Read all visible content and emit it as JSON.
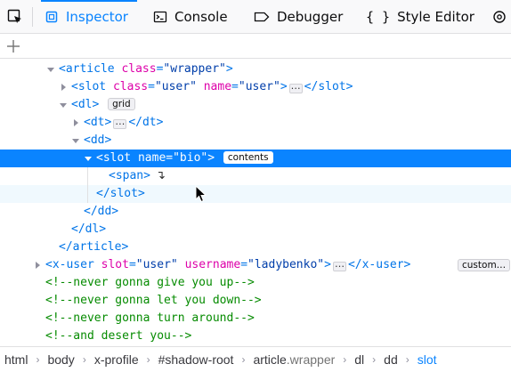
{
  "toolbar": {
    "tabs": [
      {
        "label": "Inspector",
        "icon": "inspector-icon",
        "selected": true
      },
      {
        "label": "Console",
        "icon": "console-icon",
        "selected": false
      },
      {
        "label": "Debugger",
        "icon": "debugger-icon",
        "selected": false
      },
      {
        "label": "Style Editor",
        "icon": "style-editor-icon",
        "selected": false
      }
    ],
    "accent_color": "#0a84ff"
  },
  "markup": {
    "article_open": {
      "tag": "article",
      "attr": "class",
      "val": "\"wrapper\""
    },
    "slot_user": {
      "tag": "slot",
      "attr1": "class",
      "val1": "\"user\"",
      "attr2": "name",
      "val2": "\"user\"",
      "close": "</slot>"
    },
    "dl_open": {
      "tag": "dl",
      "badge": "grid"
    },
    "dt": {
      "tag": "dt",
      "close": "</dt>"
    },
    "dd_open": {
      "tag": "dd"
    },
    "slot_bio": {
      "tag": "slot",
      "attr": "name",
      "val": "\"bio\"",
      "badge": "contents"
    },
    "span": {
      "tag": "<span>"
    },
    "slot_close": "</slot>",
    "dd_close": "</dd>",
    "dl_close": "</dl>",
    "article_close": "</article>",
    "x_user": {
      "tag": "x-user",
      "attr1": "slot",
      "val1": "\"user\"",
      "attr2": "username",
      "val2": "\"ladybenko\"",
      "close": "</x-user>",
      "badge": "custom…"
    },
    "comments": [
      "<!--never gonna give you up-->",
      "<!--never gonna let you down-->",
      "<!--never gonna turn around-->",
      "<!--and desert you-->"
    ]
  },
  "breadcrumbs": [
    {
      "label": "html",
      "cls": ""
    },
    {
      "label": "body",
      "cls": ""
    },
    {
      "label": "x-profile",
      "cls": ""
    },
    {
      "label": "#shadow-root",
      "cls": ""
    },
    {
      "label": "article",
      "cls": ".wrapper"
    },
    {
      "label": "dl",
      "cls": ""
    },
    {
      "label": "dd",
      "cls": ""
    },
    {
      "label": "slot",
      "cls": "",
      "active": true
    }
  ]
}
